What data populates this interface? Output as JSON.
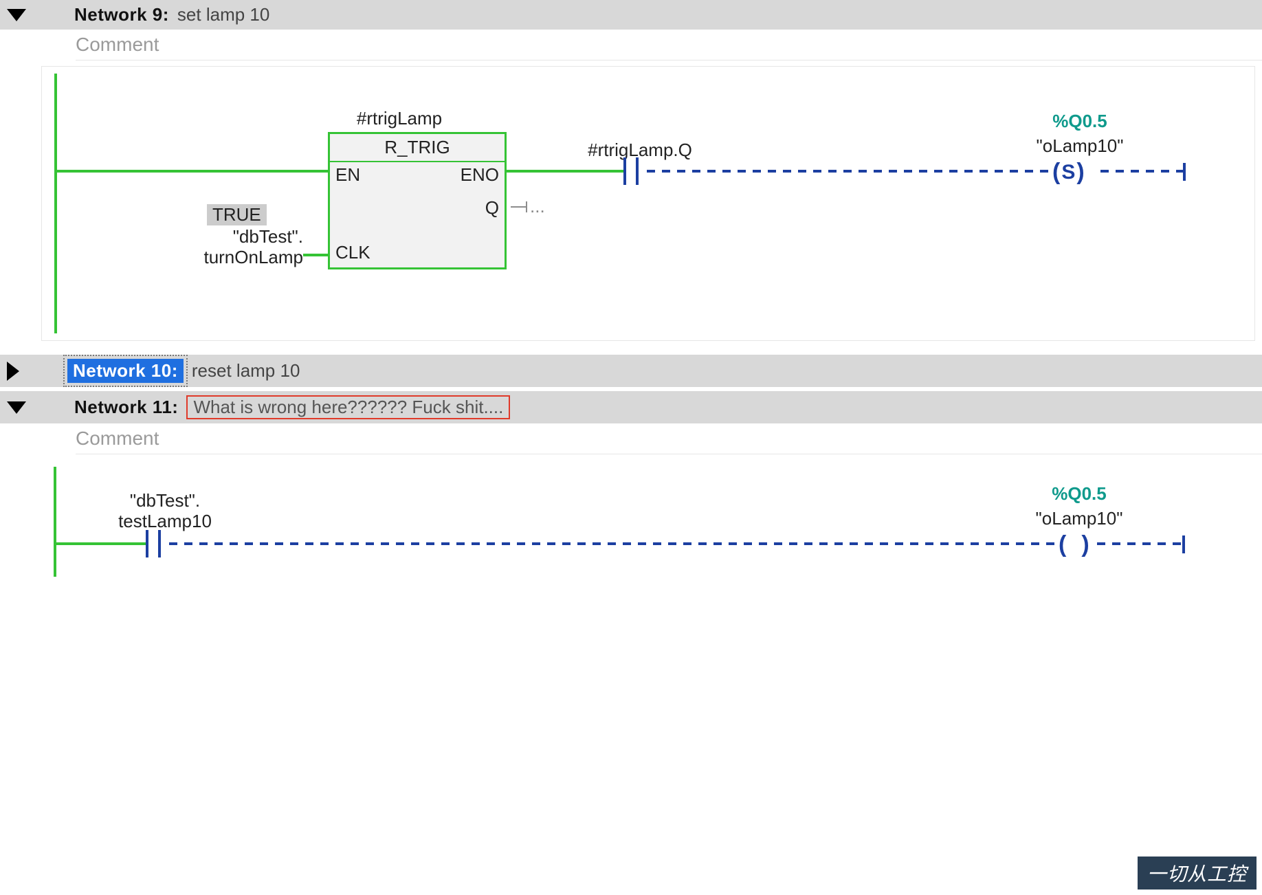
{
  "networks": {
    "n9": {
      "label": "Network 9:",
      "title": "set lamp 10",
      "comment_placeholder": "Comment",
      "fb": {
        "instance": "#rtrigLamp",
        "type": "R_TRIG",
        "pins": {
          "en": "EN",
          "eno": "ENO",
          "q": "Q",
          "clk": "CLK"
        },
        "q_stub": "..."
      },
      "clk_input": {
        "value_chip": "TRUE",
        "line1": "\"dbTest\".",
        "line2": "turnOnLamp"
      },
      "contact_tag": "#rtrigLamp.Q",
      "coil": {
        "address": "%Q0.5",
        "name": "\"oLamp10\"",
        "type": "S"
      }
    },
    "n10": {
      "label": "Network 10:",
      "title": "reset lamp 10"
    },
    "n11": {
      "label": "Network 11:",
      "title": "What is wrong here?????? Fuck shit....",
      "comment_placeholder": "Comment",
      "contact": {
        "line1": "\"dbTest\".",
        "line2": "testLamp10"
      },
      "coil": {
        "address": "%Q0.5",
        "name": "\"oLamp10\""
      }
    }
  },
  "watermark": "一切从工控"
}
